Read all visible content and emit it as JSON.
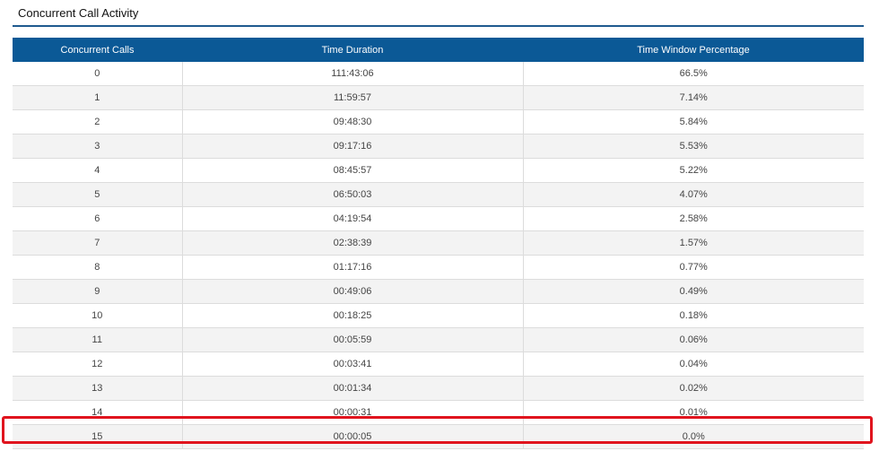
{
  "section": {
    "title": "Concurrent Call Activity"
  },
  "table": {
    "headers": [
      "Concurrent Calls",
      "Time Duration",
      "Time Window Percentage"
    ],
    "rows": [
      [
        "0",
        "111:43:06",
        "66.5%"
      ],
      [
        "1",
        "11:59:57",
        "7.14%"
      ],
      [
        "2",
        "09:48:30",
        "5.84%"
      ],
      [
        "3",
        "09:17:16",
        "5.53%"
      ],
      [
        "4",
        "08:45:57",
        "5.22%"
      ],
      [
        "5",
        "06:50:03",
        "4.07%"
      ],
      [
        "6",
        "04:19:54",
        "2.58%"
      ],
      [
        "7",
        "02:38:39",
        "1.57%"
      ],
      [
        "8",
        "01:17:16",
        "0.77%"
      ],
      [
        "9",
        "00:49:06",
        "0.49%"
      ],
      [
        "10",
        "00:18:25",
        "0.18%"
      ],
      [
        "11",
        "00:05:59",
        "0.06%"
      ],
      [
        "12",
        "00:03:41",
        "0.04%"
      ],
      [
        "13",
        "00:01:34",
        "0.02%"
      ],
      [
        "14",
        "00:00:31",
        "0.01%"
      ],
      [
        "15",
        "00:00:05",
        "0.0%"
      ]
    ]
  },
  "colors": {
    "header_bg": "#0b5996",
    "title_rule": "#1f5a8f",
    "highlight": "#e0141e"
  }
}
